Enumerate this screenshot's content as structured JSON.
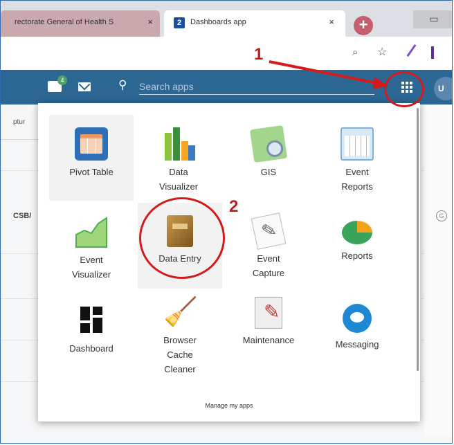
{
  "browser": {
    "tabs": [
      {
        "title": "rectorate General of Health S",
        "close": "×"
      },
      {
        "title": "Dashboards app",
        "favicon": "2",
        "close": "×"
      }
    ],
    "new_tab": "+",
    "window_controls": "▭"
  },
  "address_bar": {
    "zoom_icon": "⌕",
    "star_icon": "☆"
  },
  "header": {
    "chat_badge": "4",
    "search_placeholder": "Search apps",
    "search_icon": "⚲",
    "avatar_text": "U"
  },
  "background": {
    "text1": "ptur",
    "text2": "CSB/",
    "globe": "G"
  },
  "apps": [
    {
      "label": "Pivot Table",
      "icon": "pivot-table-icon",
      "highlighted": true
    },
    {
      "label": "Data\nVisualizer",
      "icon": "data-visualizer-icon"
    },
    {
      "label": "GIS",
      "icon": "gis-icon"
    },
    {
      "label": "Event\nReports",
      "icon": "event-reports-icon"
    },
    {
      "label": "Event\nVisualizer",
      "icon": "event-visualizer-icon"
    },
    {
      "label": "Data Entry",
      "icon": "data-entry-icon",
      "highlighted": true
    },
    {
      "label": "Event\nCapture",
      "icon": "event-capture-icon"
    },
    {
      "label": "Reports",
      "icon": "reports-icon"
    },
    {
      "label": "Dashboard",
      "icon": "dashboard-icon"
    },
    {
      "label": "Browser\nCache\nCleaner",
      "icon": "broom-icon"
    },
    {
      "label": "Maintenance",
      "icon": "maintenance-icon"
    },
    {
      "label": "Messaging",
      "icon": "messaging-icon"
    }
  ],
  "manage_link": "Manage my apps",
  "annotations": {
    "step1": "1",
    "step2": "2",
    "color": "#d41b1b"
  }
}
